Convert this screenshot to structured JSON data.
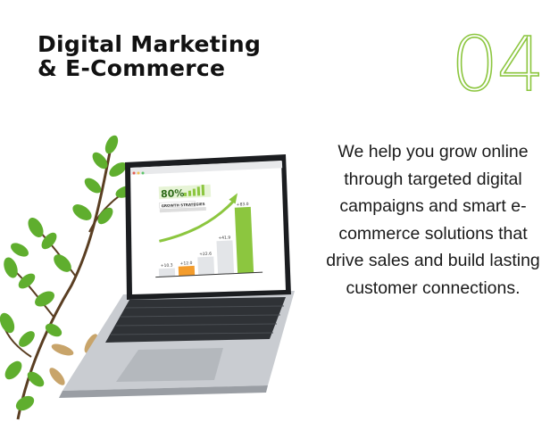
{
  "title": {
    "line1": "Digital Marketing",
    "line2": "& E-Commerce"
  },
  "number": "04",
  "description": "We help you grow online through targeted digital campaigns and smart e-commerce solutions that drive sales and build lasting customer connections.",
  "colors": {
    "accent": "#8cc63f",
    "text": "#111111",
    "orange": "#f39c2c"
  },
  "screen": {
    "percent": "80%",
    "tag": "GROWTH STRATEGIES",
    "chart_data": {
      "type": "bar",
      "categories": [
        "1",
        "2",
        "3",
        "4",
        "5"
      ],
      "values": [
        10.3,
        12.0,
        22.6,
        41.9,
        83.0
      ],
      "labels": [
        "+10.3",
        "+12.0",
        "+22.6",
        "+41.9",
        "+83.0"
      ],
      "ylim": [
        0,
        90
      ]
    }
  }
}
